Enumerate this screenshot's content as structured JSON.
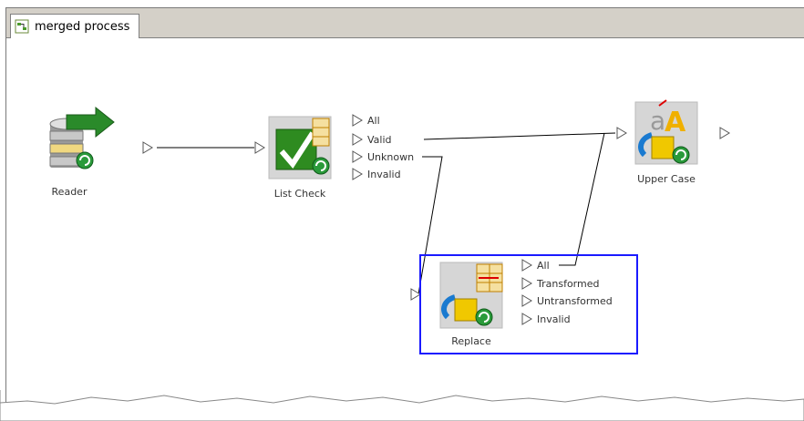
{
  "tab": {
    "title": "merged process"
  },
  "nodes": {
    "reader": {
      "label": "Reader"
    },
    "list_check": {
      "label": "List Check",
      "ports": [
        "All",
        "Valid",
        "Unknown",
        "Invalid"
      ]
    },
    "upper_case": {
      "label": "Upper Case"
    },
    "replace": {
      "label": "Replace",
      "ports": [
        "All",
        "Transformed",
        "Untransformed",
        "Invalid"
      ]
    }
  },
  "colors": {
    "selection": "#1a1aff",
    "check_green": "#2e8b20",
    "arrow_green": "#2a8a2a"
  }
}
